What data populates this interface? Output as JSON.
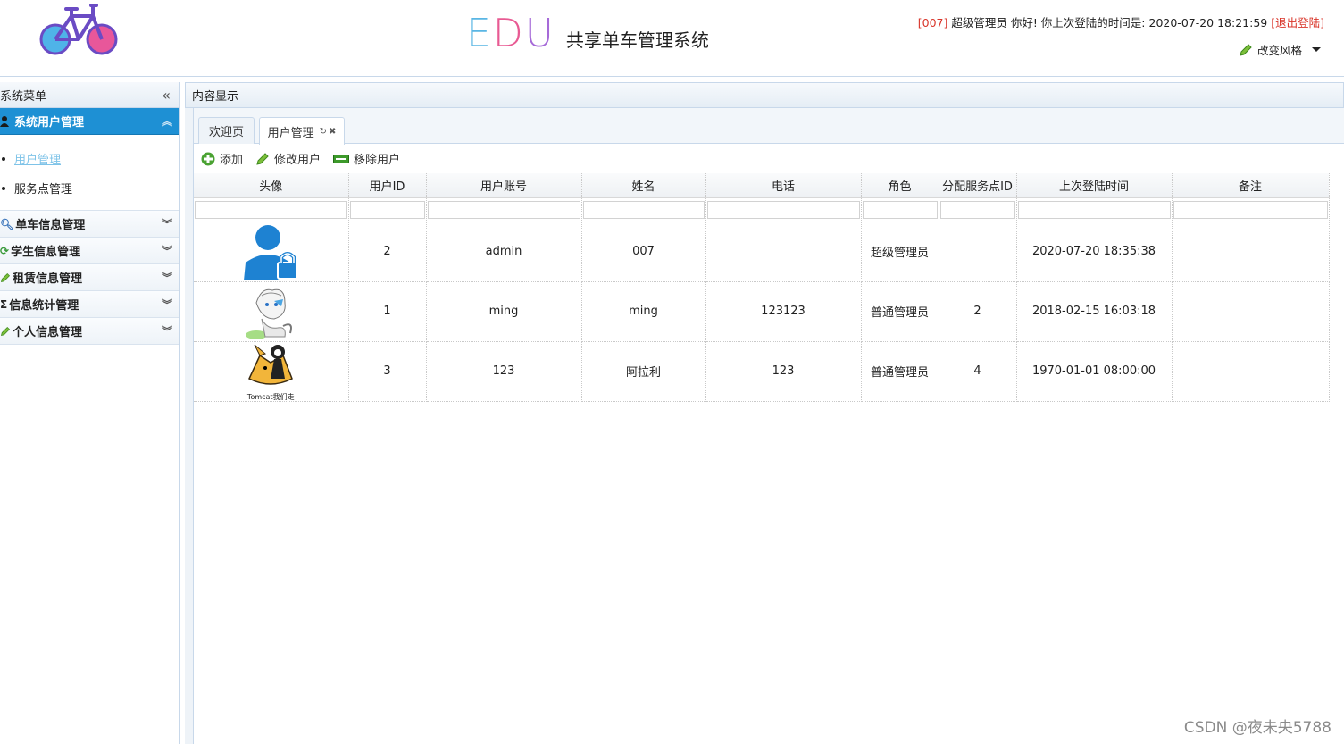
{
  "header": {
    "brand_edu_e": "E",
    "brand_edu_d": "D",
    "brand_edu_u": "U",
    "brand_name": "共享单车管理系统",
    "user_id_tag": "[007]",
    "user_greeting": " 超级管理员 你好! 你上次登陆的时间是: 2020-07-20 18:21:59 ",
    "logout": "[退出登陆]",
    "change_style": "改变风格"
  },
  "sidebar": {
    "title": "系统菜单",
    "collapse_icon": "double-chevron-left-icon",
    "panels": [
      {
        "label": "系统用户管理",
        "icon": "user-icon",
        "active": true,
        "items": [
          {
            "label": "用户管理"
          },
          {
            "label": "服务点管理"
          }
        ]
      },
      {
        "label": "单车信息管理",
        "icon": "search-icon"
      },
      {
        "label": "学生信息管理",
        "icon": "refresh-icon"
      },
      {
        "label": "租赁信息管理",
        "icon": "pencil-icon"
      },
      {
        "label": "信息统计管理",
        "icon": "sigma-icon"
      },
      {
        "label": "个人信息管理",
        "icon": "pencil-icon"
      }
    ]
  },
  "main": {
    "title": "内容显示",
    "tabs": [
      {
        "label": "欢迎页"
      },
      {
        "label": "用户管理"
      }
    ],
    "toolbar": {
      "add": "添加",
      "edit": "修改用户",
      "remove": "移除用户"
    },
    "columns": [
      "头像",
      "用户ID",
      "用户账号",
      "姓名",
      "电话",
      "角色",
      "分配服务点ID",
      "上次登陆时间",
      "备注"
    ],
    "rows": [
      {
        "avatar": "user-lock-avatar",
        "id": "2",
        "account": "admin",
        "name": "007",
        "phone": "",
        "role": "超级管理员",
        "site_id": "",
        "last_login": "2020-07-20 18:35:38",
        "note": ""
      },
      {
        "avatar": "anime-avatar",
        "id": "1",
        "account": "ming",
        "name": "ming",
        "phone": "123123",
        "role": "普通管理员",
        "site_id": "2",
        "last_login": "2018-02-15 16:03:18",
        "note": ""
      },
      {
        "avatar": "tomcat-avatar",
        "avatar_caption": "Tomcat我们走",
        "id": "3",
        "account": "123",
        "name": "阿拉利",
        "phone": "123",
        "role": "普通管理员",
        "site_id": "4",
        "last_login": "1970-01-01 08:00:00",
        "note": ""
      }
    ]
  },
  "watermark": "CSDN @夜未央5788",
  "colors": {
    "accent": "#1e90d4",
    "border": "#c8d8ea",
    "logout_red": "#d9362b"
  }
}
